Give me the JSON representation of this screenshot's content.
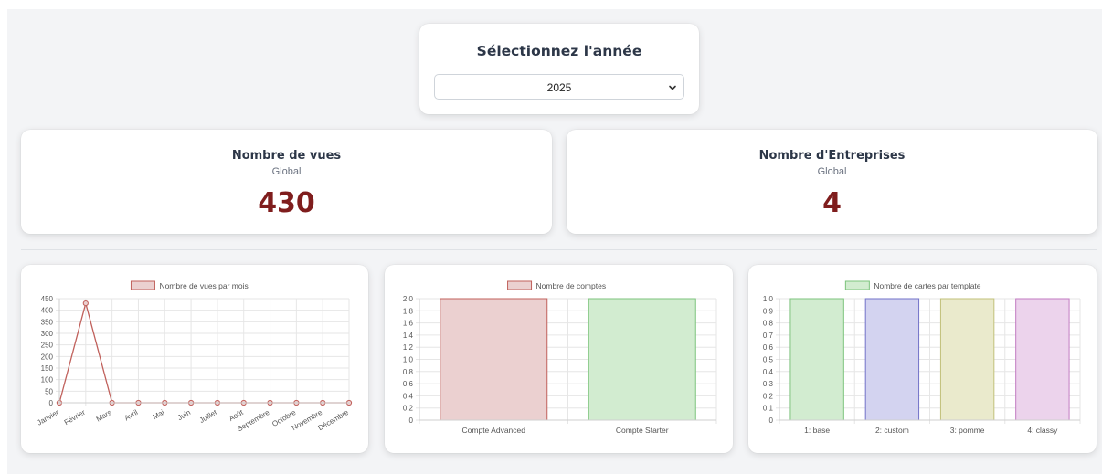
{
  "year_selector": {
    "title": "Sélectionnez l'année",
    "selected": "2025"
  },
  "stats": {
    "views": {
      "title": "Nombre de vues",
      "subtitle": "Global",
      "value": "430"
    },
    "companies": {
      "title": "Nombre d'Entreprises",
      "subtitle": "Global",
      "value": "4"
    }
  },
  "colors": {
    "value_text": "#7f1d1d",
    "red_fill": "#ebd0d0",
    "red_line": "#c0605b",
    "green_fill": "#d2ecd0",
    "green_line": "#7cc37c",
    "blue_fill": "#d3d3f0",
    "blue_line": "#7272c8",
    "olive_fill": "#eaeacc",
    "olive_line": "#c2c07a",
    "purple_fill": "#ecd3ec",
    "purple_line": "#c27ac2"
  },
  "chart_data": [
    {
      "type": "line",
      "legend": [
        "Nombre de vues par mois"
      ],
      "categories": [
        "Janvier",
        "Février",
        "Mars",
        "Avril",
        "Mai",
        "Juin",
        "Juillet",
        "Août",
        "Septembre",
        "Octobre",
        "Novembre",
        "Décembre"
      ],
      "series": [
        {
          "name": "Nombre de vues par mois",
          "values": [
            0,
            430,
            0,
            0,
            0,
            0,
            0,
            0,
            0,
            0,
            0,
            0
          ]
        }
      ],
      "ylim": [
        0,
        450
      ],
      "yticks": [
        "0",
        "50",
        "100",
        "150",
        "200",
        "250",
        "300",
        "350",
        "400",
        "450"
      ],
      "grid": true,
      "legend_position": "top"
    },
    {
      "type": "bar",
      "legend": [
        "Nombre de comptes"
      ],
      "categories": [
        "Compte Advanced",
        "Compte Starter"
      ],
      "series": [
        {
          "name": "Nombre de comptes",
          "values": [
            2,
            2
          ]
        }
      ],
      "ylim": [
        0,
        2
      ],
      "yticks": [
        "0",
        "0.2",
        "0.4",
        "0.6",
        "0.8",
        "1.0",
        "1.2",
        "1.4",
        "1.6",
        "1.8",
        "2.0"
      ],
      "grid": true,
      "legend_position": "top"
    },
    {
      "type": "bar",
      "legend": [
        "Nombre de cartes par template"
      ],
      "categories": [
        "1: base",
        "2: custom",
        "3: pomme",
        "4: classy"
      ],
      "series": [
        {
          "name": "Nombre de cartes par template",
          "values": [
            1,
            1,
            1,
            1
          ]
        }
      ],
      "ylim": [
        0,
        1
      ],
      "yticks": [
        "0",
        "0.1",
        "0.2",
        "0.3",
        "0.4",
        "0.5",
        "0.6",
        "0.7",
        "0.8",
        "0.9",
        "1.0"
      ],
      "grid": true,
      "legend_position": "top"
    }
  ]
}
